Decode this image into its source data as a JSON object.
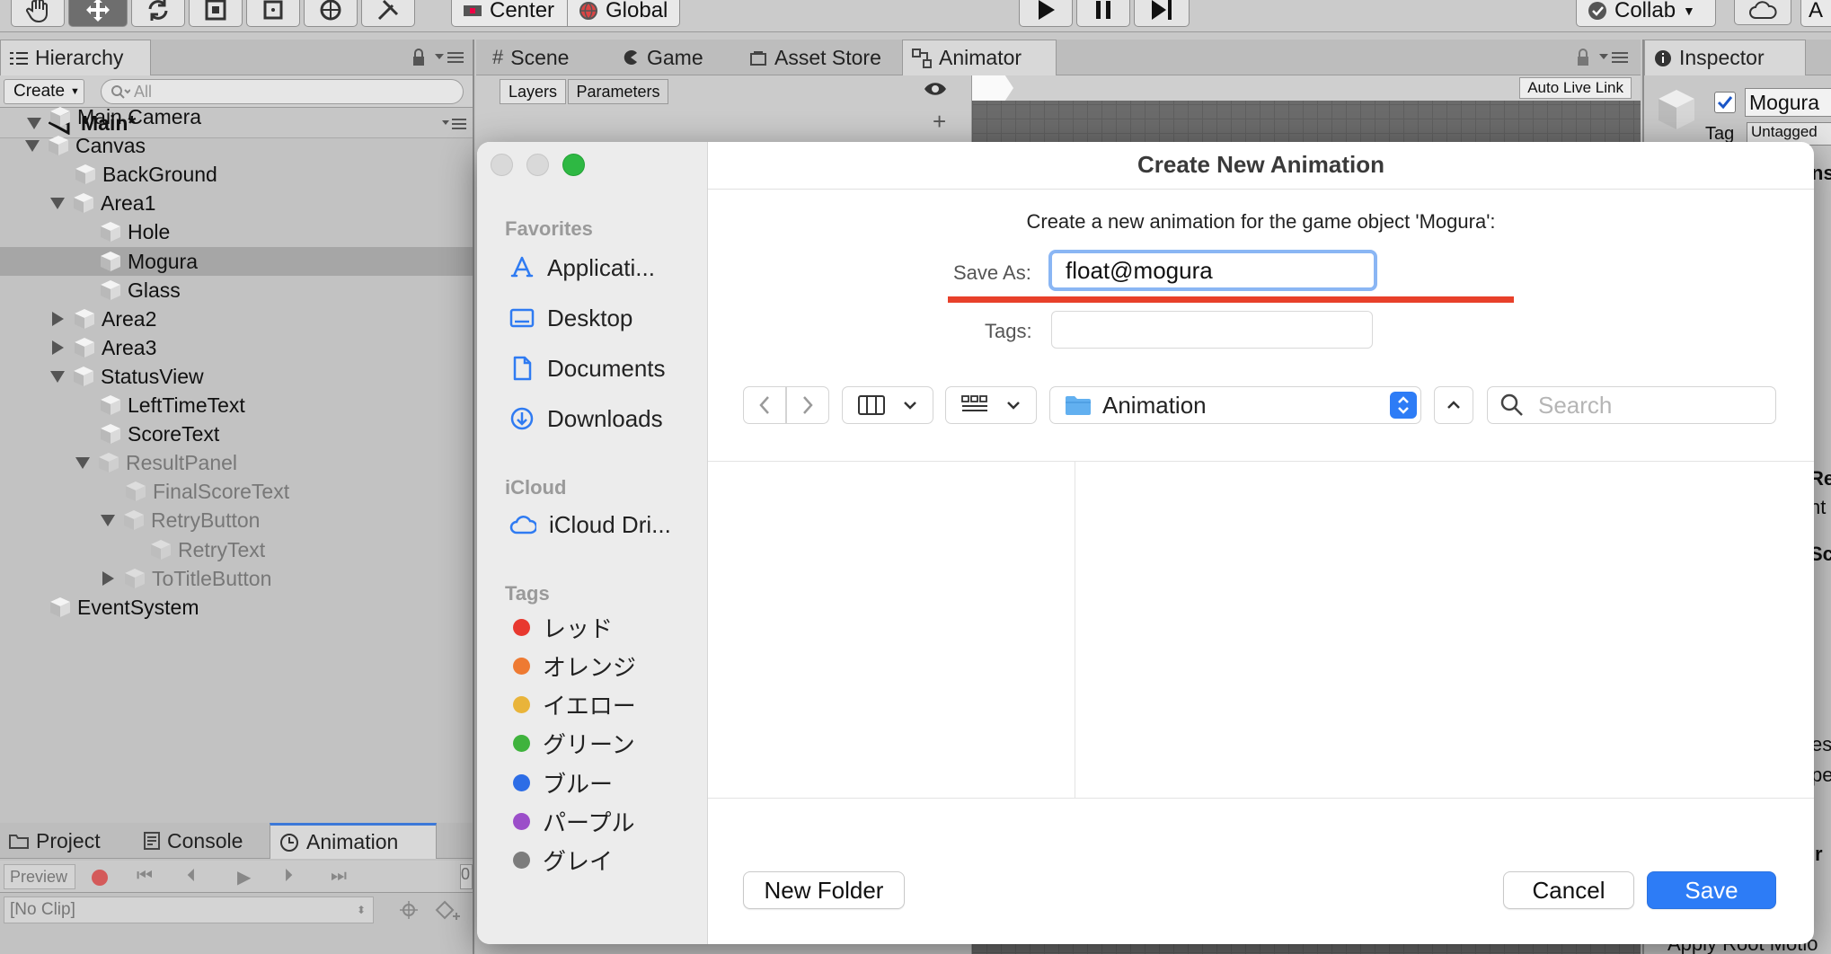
{
  "toolbar": {
    "center_label": "Center",
    "global_label": "Global",
    "collab_label": "Collab",
    "account_label": "A"
  },
  "hierarchy": {
    "tab_label": "Hierarchy",
    "create_label": "Create",
    "search_placeholder": "All",
    "scene_name": "Main*",
    "items": [
      {
        "label": "Main Camera",
        "level": 1,
        "expander": "none",
        "state": "normal"
      },
      {
        "label": "Canvas",
        "level": 1,
        "expander": "down",
        "state": "normal"
      },
      {
        "label": "BackGround",
        "level": 2,
        "expander": "none",
        "state": "normal"
      },
      {
        "label": "Area1",
        "level": 2,
        "expander": "down",
        "state": "normal"
      },
      {
        "label": "Hole",
        "level": 3,
        "expander": "none",
        "state": "normal"
      },
      {
        "label": "Mogura",
        "level": 3,
        "expander": "none",
        "state": "selected"
      },
      {
        "label": "Glass",
        "level": 3,
        "expander": "none",
        "state": "normal"
      },
      {
        "label": "Area2",
        "level": 2,
        "expander": "right",
        "state": "normal"
      },
      {
        "label": "Area3",
        "level": 2,
        "expander": "right",
        "state": "normal"
      },
      {
        "label": "StatusView",
        "level": 2,
        "expander": "down",
        "state": "normal"
      },
      {
        "label": "LeftTimeText",
        "level": 3,
        "expander": "none",
        "state": "normal"
      },
      {
        "label": "ScoreText",
        "level": 3,
        "expander": "none",
        "state": "normal"
      },
      {
        "label": "ResultPanel",
        "level": 3,
        "expander": "down",
        "state": "dim"
      },
      {
        "label": "FinalScoreText",
        "level": 4,
        "expander": "none",
        "state": "dim"
      },
      {
        "label": "RetryButton",
        "level": 4,
        "expander": "down",
        "state": "dim"
      },
      {
        "label": "RetryText",
        "level": 5,
        "expander": "none",
        "state": "dim"
      },
      {
        "label": "ToTitleButton",
        "level": 4,
        "expander": "right",
        "state": "dim"
      },
      {
        "label": "EventSystem",
        "level": 1,
        "expander": "none",
        "state": "normal"
      }
    ]
  },
  "center_tabs": {
    "scene": "Scene",
    "game": "Game",
    "asset_store": "Asset Store",
    "animator": "Animator"
  },
  "animator": {
    "layers_tab": "Layers",
    "parameters_tab": "Parameters",
    "auto_live_link": "Auto Live Link"
  },
  "inspector": {
    "tab_label": "Inspector",
    "object_name": "Mogura",
    "tag_label": "Tag",
    "tag_value": "Untagged",
    "edge_texts": [
      "ns",
      "Re",
      "nt",
      "Sc",
      "es",
      "pe",
      "r"
    ],
    "bottom_text": "Apply Root Motio"
  },
  "bottom": {
    "project_tab": "Project",
    "console_tab": "Console",
    "animation_tab": "Animation",
    "preview_label": "Preview",
    "frame_value": "0",
    "clip_value": "[No Clip]"
  },
  "dialog": {
    "title": "Create New Animation",
    "message": "Create a new animation for the game object 'Mogura':",
    "save_as_label": "Save As:",
    "save_as_value": "float@mogura",
    "tags_label": "Tags:",
    "tags_value": "",
    "location": "Animation",
    "search_placeholder": "Search",
    "new_folder": "New Folder",
    "cancel": "Cancel",
    "save": "Save",
    "highlight_color": "#e8402a",
    "sidebar": {
      "favorites_title": "Favorites",
      "favorites": [
        {
          "label": "Applicati...",
          "icon": "applications-icon"
        },
        {
          "label": "Desktop",
          "icon": "desktop-icon"
        },
        {
          "label": "Documents",
          "icon": "document-icon"
        },
        {
          "label": "Downloads",
          "icon": "download-icon"
        }
      ],
      "icloud_title": "iCloud",
      "icloud": [
        {
          "label": "iCloud Dri...",
          "icon": "cloud-icon"
        }
      ],
      "tags_title": "Tags",
      "tags": [
        {
          "label": "レッド",
          "color": "#e8382f"
        },
        {
          "label": "オレンジ",
          "color": "#ee7a32"
        },
        {
          "label": "イエロー",
          "color": "#e9b43a"
        },
        {
          "label": "グリーン",
          "color": "#3fb33d"
        },
        {
          "label": "ブルー",
          "color": "#2d6de6"
        },
        {
          "label": "パープル",
          "color": "#9b4ec9"
        },
        {
          "label": "グレイ",
          "color": "#7c7c7c"
        }
      ]
    }
  }
}
